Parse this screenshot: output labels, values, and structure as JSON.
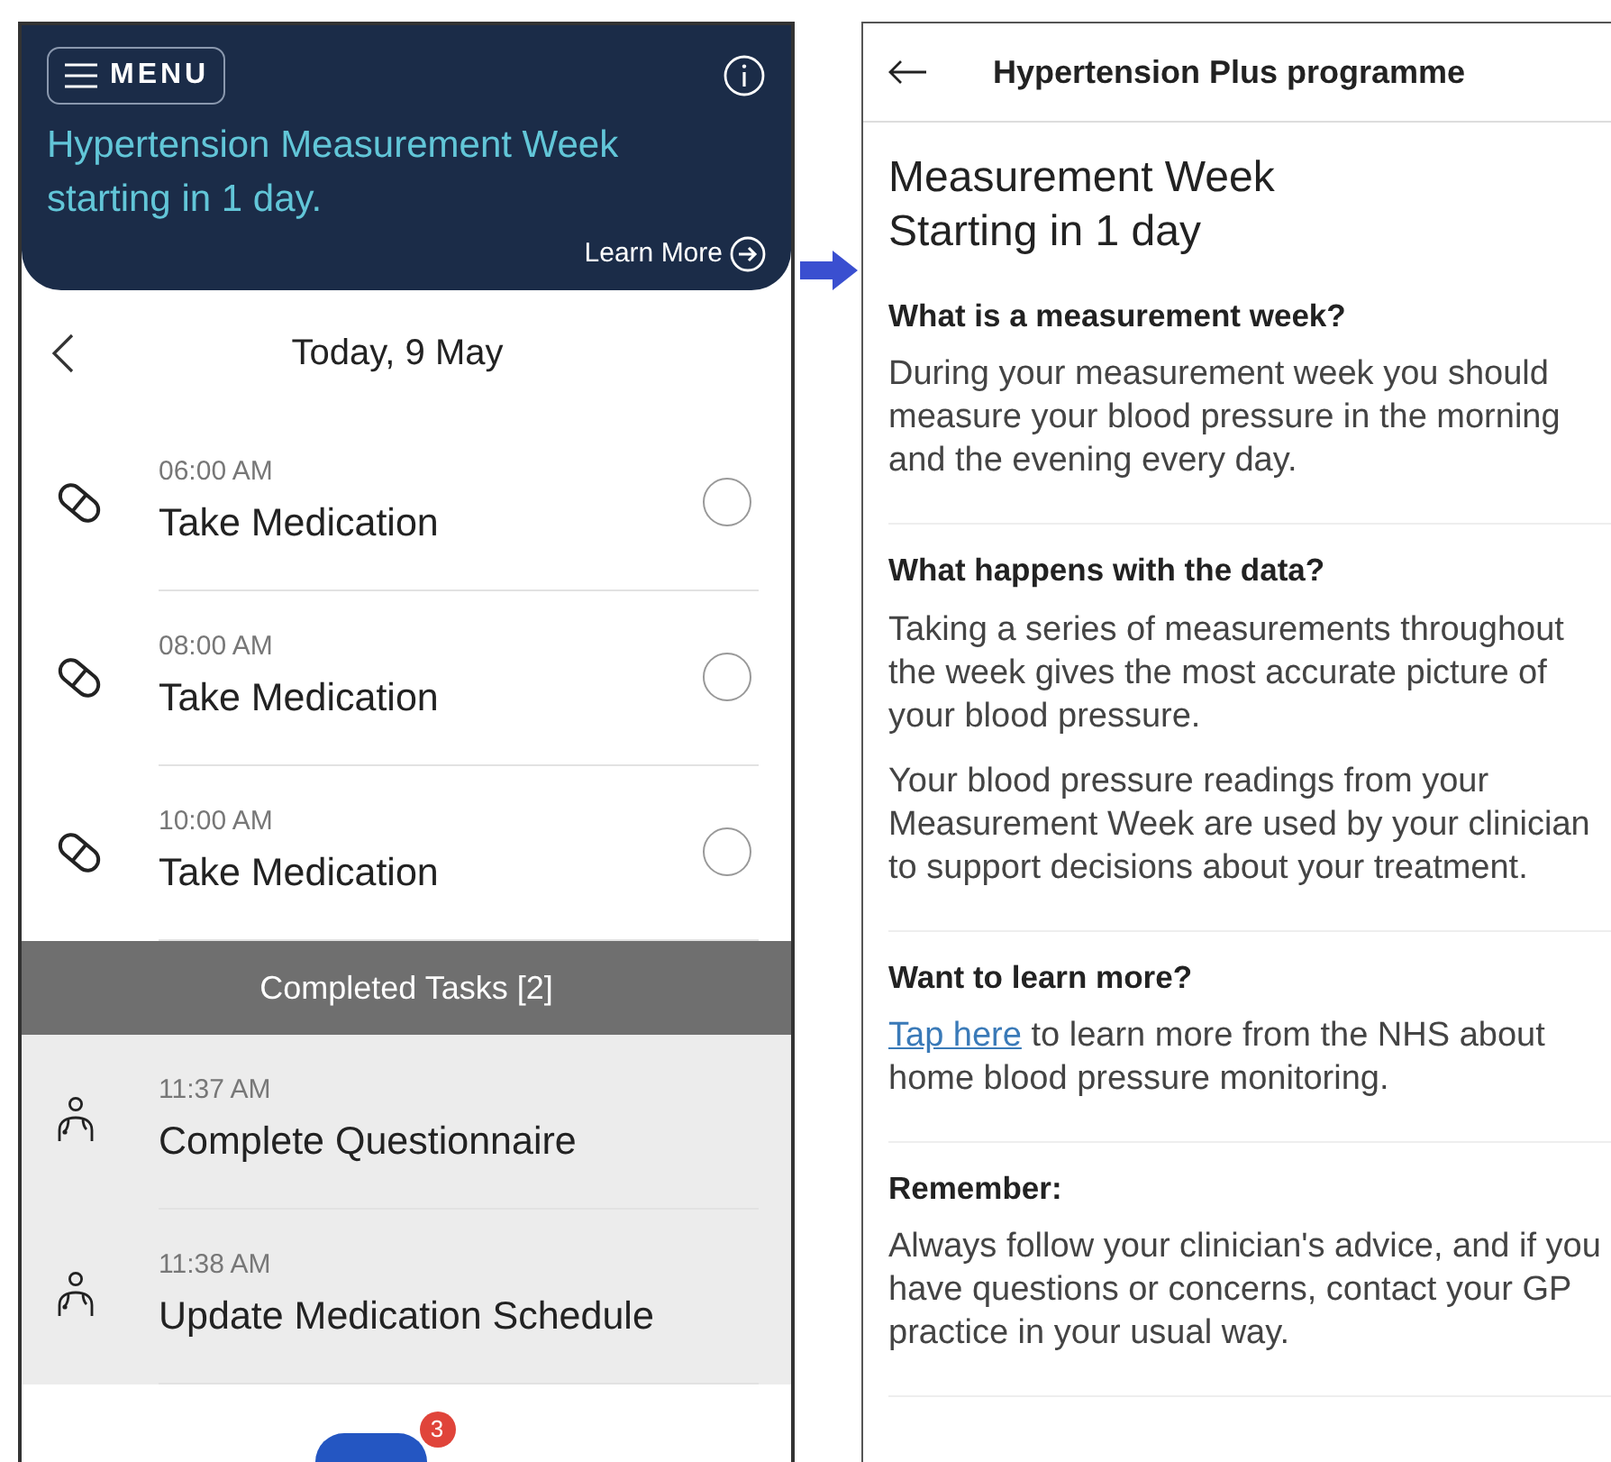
{
  "left_screen": {
    "header": {
      "menu_label": "MENU",
      "banner_text": "Hypertension Measurement Week starting in 1 day.",
      "learn_more": "Learn More"
    },
    "date_nav": {
      "title": "Today, 9 May"
    },
    "tasks": [
      {
        "kind": "medication",
        "time": "06:00 AM",
        "title": "Take Medication",
        "checked": false
      },
      {
        "kind": "medication",
        "time": "08:00 AM",
        "title": "Take Medication",
        "checked": false
      },
      {
        "kind": "medication",
        "time": "10:00 AM",
        "title": "Take Medication",
        "checked": false
      }
    ],
    "completed_header": "Completed Tasks [2]",
    "completed_tasks": [
      {
        "kind": "clinician",
        "time": "11:37 AM",
        "title": "Complete Questionnaire"
      },
      {
        "kind": "clinician",
        "time": "11:38 AM",
        "title": "Update Medication Schedule"
      }
    ],
    "fab": {
      "badge": "3"
    }
  },
  "right_screen": {
    "title": "Hypertension Plus programme",
    "heading_lines": [
      "Measurement Week",
      "Starting in 1 day"
    ],
    "sections": [
      {
        "heading": "What is a measurement week?",
        "paragraphs": [
          {
            "text": "During your measurement week you should measure your blood pressure in the morning and the evening every day."
          }
        ]
      },
      {
        "heading": "What happens with the data?",
        "paragraphs": [
          {
            "text": "Taking a series of measurements throughout the week gives the most accurate picture of your blood pressure."
          },
          {
            "text": "Your blood pressure readings from your Measurement Week are used by your clinician to support decisions about your treatment."
          }
        ]
      },
      {
        "heading": "Want to learn more?",
        "paragraphs": [
          {
            "link": "Tap here",
            "text": " to learn more from the NHS about home blood pressure monitoring."
          }
        ]
      },
      {
        "heading": "Remember:",
        "paragraphs": [
          {
            "text": "Always follow your clinician's advice, and if you have questions or concerns, contact your GP practice in your usual way."
          }
        ]
      }
    ]
  }
}
